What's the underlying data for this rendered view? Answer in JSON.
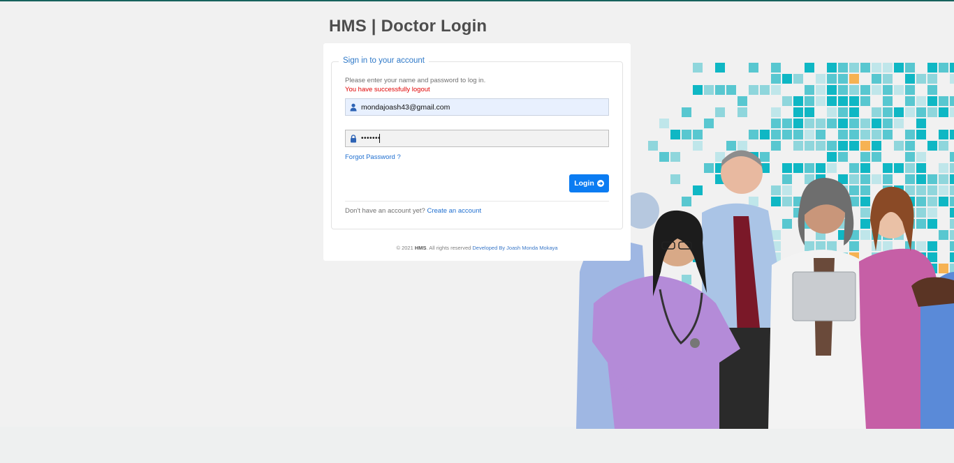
{
  "page": {
    "title": "HMS | Doctor Login"
  },
  "login_form": {
    "legend": "Sign in to your account",
    "instructions": "Please enter your name and password to log in.",
    "status_message": "You have successfully logout",
    "email": {
      "value": "mondajoash43@gmail.com",
      "icon": "user-icon"
    },
    "password": {
      "value": "abcdefg",
      "icon": "lock-icon"
    },
    "forgot_password_label": "Forgot Password ?",
    "login_button_label": "Login",
    "login_button_icon": "arrow-circle-right-icon",
    "signup_prompt": "Don't have an account yet?",
    "signup_link": "Create an account"
  },
  "footer": {
    "copyright": "© 2021",
    "brand": "HMS",
    "rights": ". All rights reserved",
    "developer_link": "Developed By Joash Monda Mokaya"
  },
  "colors": {
    "accent": "#0b7cf2",
    "error": "#e00000",
    "link": "#1f6fd0",
    "tile_palette": [
      "#0fb7c4",
      "#58c7d0",
      "#8fd6dc",
      "#bfe6ea",
      "#e23b6b",
      "#f6b253",
      "#b07cc4"
    ]
  }
}
